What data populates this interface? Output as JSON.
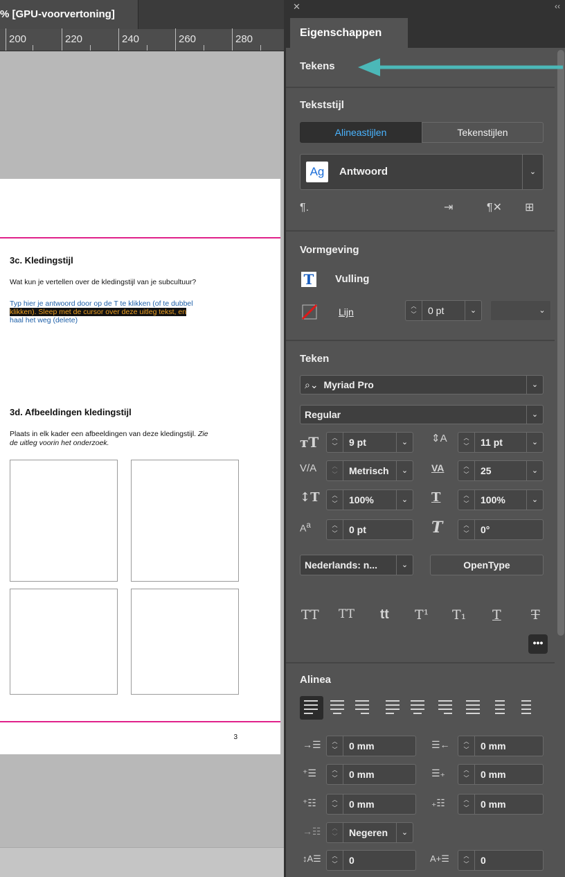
{
  "document": {
    "tab_title": "% [GPU-voorvertoning]",
    "ruler_labels": [
      "200",
      "220",
      "240",
      "260",
      "280"
    ],
    "section_3c": {
      "heading": "3c. Kledingstijl",
      "question": "Wat kun je vertellen over de kledingstijl van je subcultuur?",
      "placeholder_line1": "Typ hier je antwoord door op de T te klikken (of te dubbel",
      "placeholder_line2_highlighted": "klikken). Sleep met de cursor over deze uitleg tekst, en",
      "placeholder_line3": "haal het weg (delete)"
    },
    "section_3d": {
      "heading": "3d. Afbeeldingen kledingstijl",
      "instruction_line1": "Plaats in elk kader een afbeeldingen van deze kledingstijl. ",
      "instruction_line1_italic": "Zie",
      "instruction_line2_italic": "de uitleg voorin het onderzoek."
    },
    "page_number": "3",
    "colors": {
      "guide": "#e0218a",
      "placeholder_text": "#1d5fa8",
      "highlight_bg": "#111111",
      "highlight_text": "#f0a020"
    }
  },
  "panel": {
    "tab_label": "Eigenschappen",
    "selection_label": "Tekens",
    "arrow_color": "#4bb8b8",
    "text_style": {
      "title": "Tekststijl",
      "segment_paragraph": "Alineastijlen",
      "segment_character": "Tekenstijlen",
      "style_icon_text": "Ag",
      "style_name": "Antwoord"
    },
    "appearance": {
      "title": "Vormgeving",
      "fill_label": "Vulling",
      "stroke_label": "Lijn",
      "stroke_weight": "0 pt"
    },
    "character": {
      "title": "Teken",
      "font_family": "Myriad Pro",
      "font_style": "Regular",
      "font_size": "9 pt",
      "leading": "11 pt",
      "kerning": "Metrisch",
      "tracking": "25",
      "vertical_scale": "100%",
      "horizontal_scale": "100%",
      "baseline_shift": "0 pt",
      "skew": "0°",
      "language": "Nederlands: n...",
      "opentype_button": "OpenType",
      "type_buttons": [
        "TT",
        "TT",
        "tt",
        "T¹",
        "T₁",
        "T",
        "T"
      ]
    },
    "paragraph": {
      "title": "Alinea",
      "left_indent": "0 mm",
      "right_indent": "0 mm",
      "first_line_indent": "0 mm",
      "last_line_indent": "0 mm",
      "space_before": "0 mm",
      "space_after": "0 mm",
      "grid_align": "Negeren",
      "drop_cap_lines": "0",
      "drop_cap_chars": "0"
    },
    "accent_color": "#4ab4ff"
  }
}
